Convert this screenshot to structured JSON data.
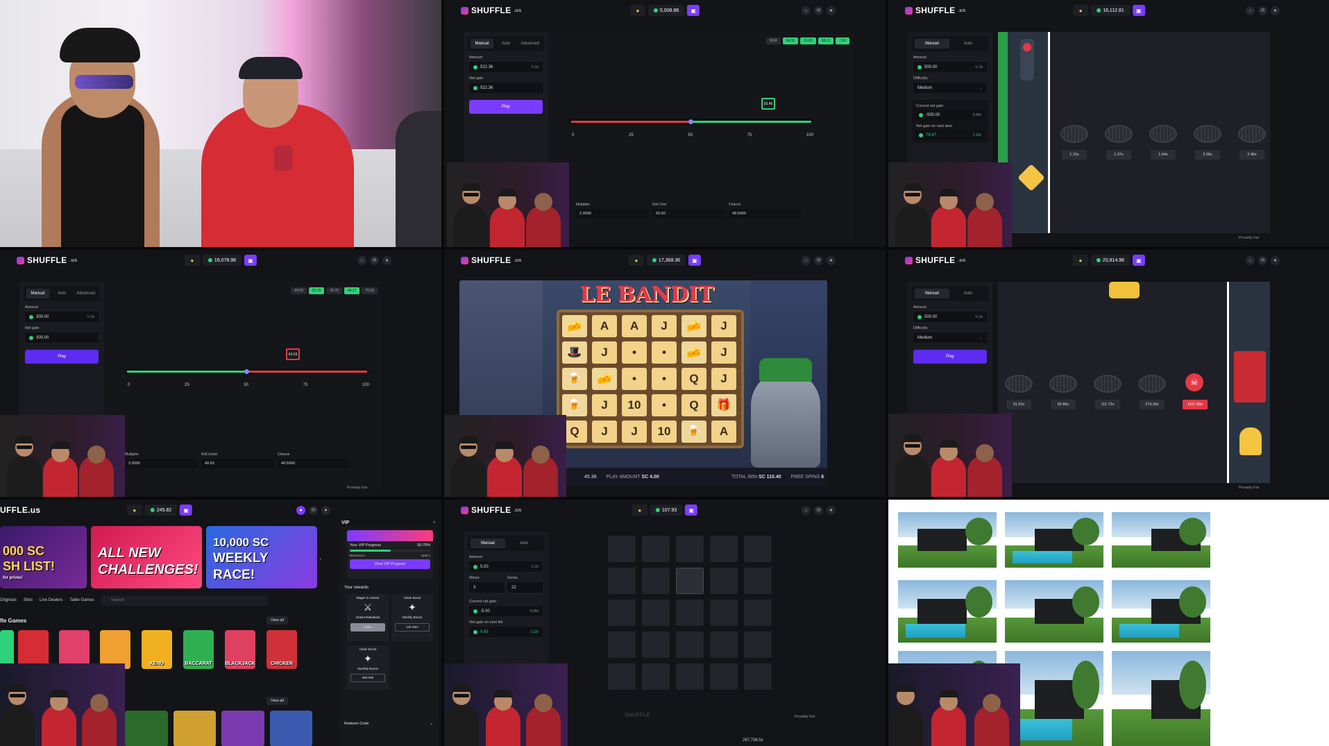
{
  "brand": {
    "name": "SHUFFLE",
    "suffix": ".us",
    "name_cut": "UFFLE.us"
  },
  "cells": {
    "dice1": {
      "balance": "5,008.88",
      "tabs": [
        "Manual",
        "Auto",
        "Advanced"
      ],
      "amount_label": "Amount",
      "amount": "522.36",
      "net_label": "Net gain",
      "net": "522.36",
      "play": "Play",
      "history": [
        "2024",
        "64.36",
        "51.05",
        "68.21",
        "7.69"
      ],
      "marker": "93.46",
      "ticks": [
        "0",
        "25",
        "50",
        "75",
        "100"
      ],
      "stats": [
        {
          "label": "Multiplier",
          "value": "2.0000"
        },
        {
          "label": "Roll Over",
          "value": "50.50"
        },
        {
          "label": "Chance",
          "value": "49.5000"
        }
      ]
    },
    "chicken1": {
      "balance": "16,112.81",
      "tabs": [
        "Manual",
        "Auto"
      ],
      "amount_label": "Amount",
      "amount": "500.00",
      "difficulty_label": "Difficulty",
      "difficulty": "Medium",
      "current_label": "Current net gain",
      "current": "-500.00",
      "current_pct": "0.00x",
      "next_label": "Net gain on next lane",
      "next": "76.47",
      "next_mult": "1.15x",
      "multipliers": [
        "1.15x",
        "1.37x",
        "1.64x",
        "2.00x",
        "2.46x"
      ],
      "fair": "Provably Fair"
    },
    "dice2": {
      "balance": "16,076.96",
      "tabs": [
        "Manual",
        "Auto",
        "Advanced"
      ],
      "amount_label": "Amount",
      "amount": "300.00",
      "net_label": "Net gain",
      "net": "300.00",
      "play": "Play",
      "history": [
        "84.63",
        "82.15",
        "16.76",
        "44.17",
        "75.06"
      ],
      "marker": "64.53",
      "ticks": [
        "0",
        "25",
        "50",
        "75",
        "100"
      ],
      "stats": [
        {
          "label": "Multiplier",
          "value": "2.0000"
        },
        {
          "label": "Roll Under",
          "value": "49.50"
        },
        {
          "label": "Chance",
          "value": "49.5000"
        }
      ],
      "fair": "Provably Fair"
    },
    "slot": {
      "balance": "17,368.36",
      "title": "LE BANDIT",
      "play_amount_label": "PLAY AMOUNT",
      "play_amount": "SC 4.00",
      "total_win_label": "TOTAL WIN",
      "total_win": "SC 110.40",
      "free_spins_label": "FREE SPINS",
      "free_spins": "6",
      "side_value": "45.38"
    },
    "chicken2": {
      "balance": "20,814.96",
      "tabs": [
        "Manual",
        "Auto"
      ],
      "amount_label": "Amount",
      "amount": "500.00",
      "difficulty_label": "Difficulty",
      "difficulty": "Medium",
      "play": "Play",
      "multipliers": [
        "31.92x",
        "55.86x",
        "111.72x",
        "279.30x",
        "1117.30x"
      ],
      "fair": "Provably Fair"
    },
    "lobby": {
      "balance": "245.82",
      "promos": [
        {
          "title": "000 SC",
          "sub": "SH LIST!",
          "tag": "for prizes!"
        },
        {
          "title": "ALL NEW",
          "sub": "CHALLENGES!"
        },
        {
          "title": "10,000 SC",
          "sub": "WEEKLY",
          "extra": "RACE!"
        }
      ],
      "filters": [
        "Originals",
        "Slots",
        "Live Dealers",
        "Table Games"
      ],
      "search_placeholder": "Search",
      "section": "fle Games",
      "view_all": "View all",
      "games": [
        "KENO",
        "BACCARAT",
        "BLACKJACK",
        "CHICKEN"
      ],
      "vip_title": "VIP",
      "vip_progress_label": "Your VIP Progress",
      "vip_progress": "50.70%",
      "vip_from": "Diamond 5",
      "vip_to": "Opal 1",
      "vip_button": "View VIP Program",
      "rewards": "Your rewards",
      "wager_label": "Wager to Unlock",
      "rakeback": "Instant Rakeback",
      "claim": "Claim",
      "claim_boost": "Claim Boost",
      "weekly": "Weekly Bonus",
      "weekly_time": "14h 56m",
      "monthly": "Monthly Bonus",
      "monthly_time": "08d 03h",
      "redeem": "Redeem Code"
    },
    "mines": {
      "balance": "107.93",
      "tabs": [
        "Manual",
        "Auto"
      ],
      "amount_label": "Amount",
      "amount": "5.00",
      "mines_label": "Mines",
      "mines": "3",
      "gems_label": "Gems",
      "gems": "22",
      "current_label": "Current net gain",
      "current": "-5.00",
      "current_pct": "0.00x",
      "next_label": "Net gain on next tile",
      "next": "0.63",
      "next_mult": "1.13x",
      "fair": "Provably Fair",
      "bottom_balance": "267,736.5x"
    }
  },
  "colors": {
    "accent": "#7b3cff",
    "green": "#2fd17a",
    "red": "#e53946",
    "panel": "#1a1b20"
  }
}
